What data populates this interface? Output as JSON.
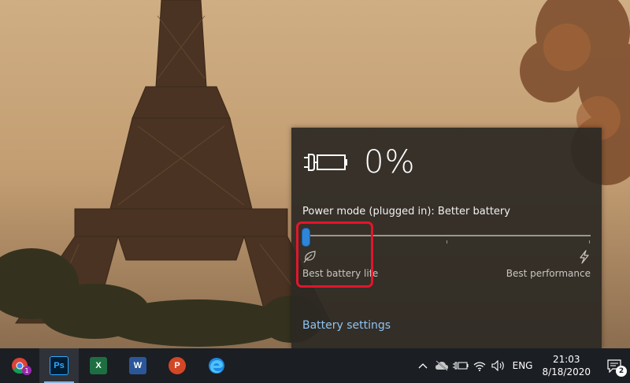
{
  "flyout": {
    "percent": "0%",
    "power_mode": "Power mode (plugged in): Better battery",
    "slider_level": 0,
    "label_left": "Best battery life",
    "label_right": "Best performance",
    "settings_link": "Battery settings"
  },
  "taskbar": {
    "apps": [
      {
        "name": "Chrome",
        "badge": "1"
      },
      {
        "name": "Photoshop",
        "label": "Ps"
      },
      {
        "name": "Excel",
        "label": "X"
      },
      {
        "name": "Word",
        "label": "W"
      },
      {
        "name": "PowerPoint",
        "label": "P"
      },
      {
        "name": "Edge"
      }
    ],
    "language": "ENG",
    "time": "21:03",
    "date": "8/18/2020",
    "notification_count": "2"
  },
  "colors": {
    "accent": "#2d86d8",
    "highlight": "#e3152b",
    "link": "#8fc3f2",
    "taskbar": "#1b1e23",
    "flyout": "#2c2924"
  }
}
